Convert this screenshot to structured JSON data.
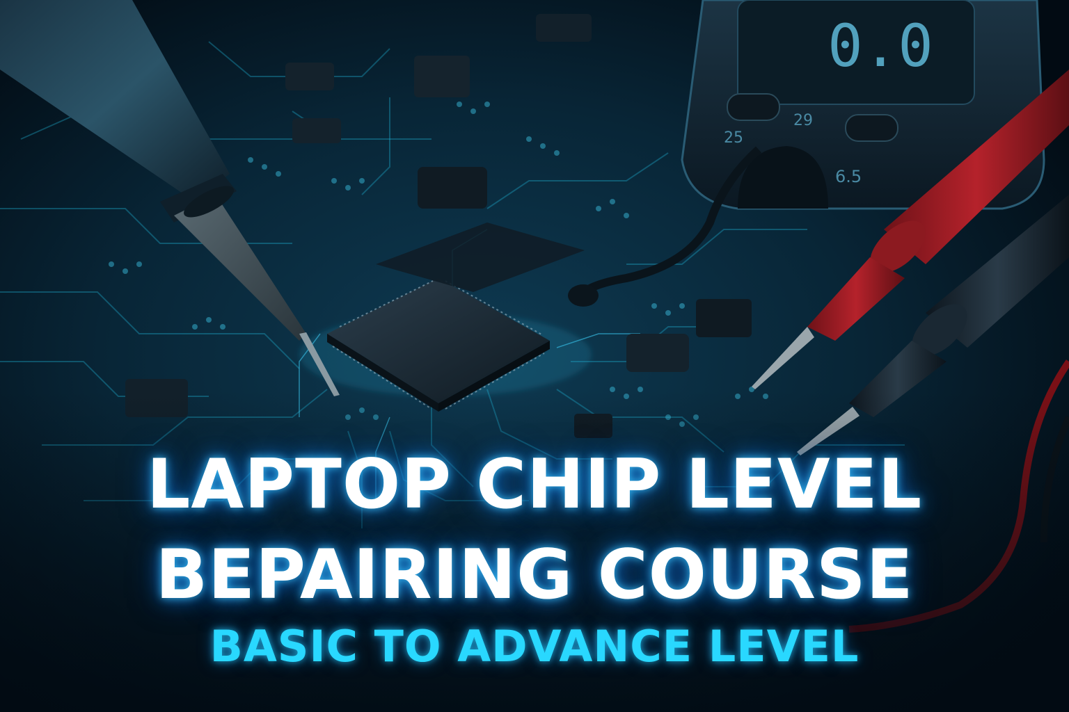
{
  "title": {
    "line1": "LAPTOP CHIP LEVEL",
    "line2": "BEPAIRING COURSE",
    "subtitle": "BASIC TO ADVANCE LEVEL"
  },
  "multimeter": {
    "display": "0.0",
    "labels": [
      "25",
      "29",
      "6.5"
    ]
  },
  "colors": {
    "background": "#03111c",
    "trace_glow": "#1fb4d8",
    "title_text": "#ffffff",
    "subtitle_text": "#29d8ff",
    "probe_red": "#a81c22",
    "probe_black": "#1b2733"
  },
  "scene_elements": [
    "circuit-board",
    "soldering-iron",
    "cpu-chip",
    "multimeter",
    "red-probe",
    "black-probe"
  ]
}
